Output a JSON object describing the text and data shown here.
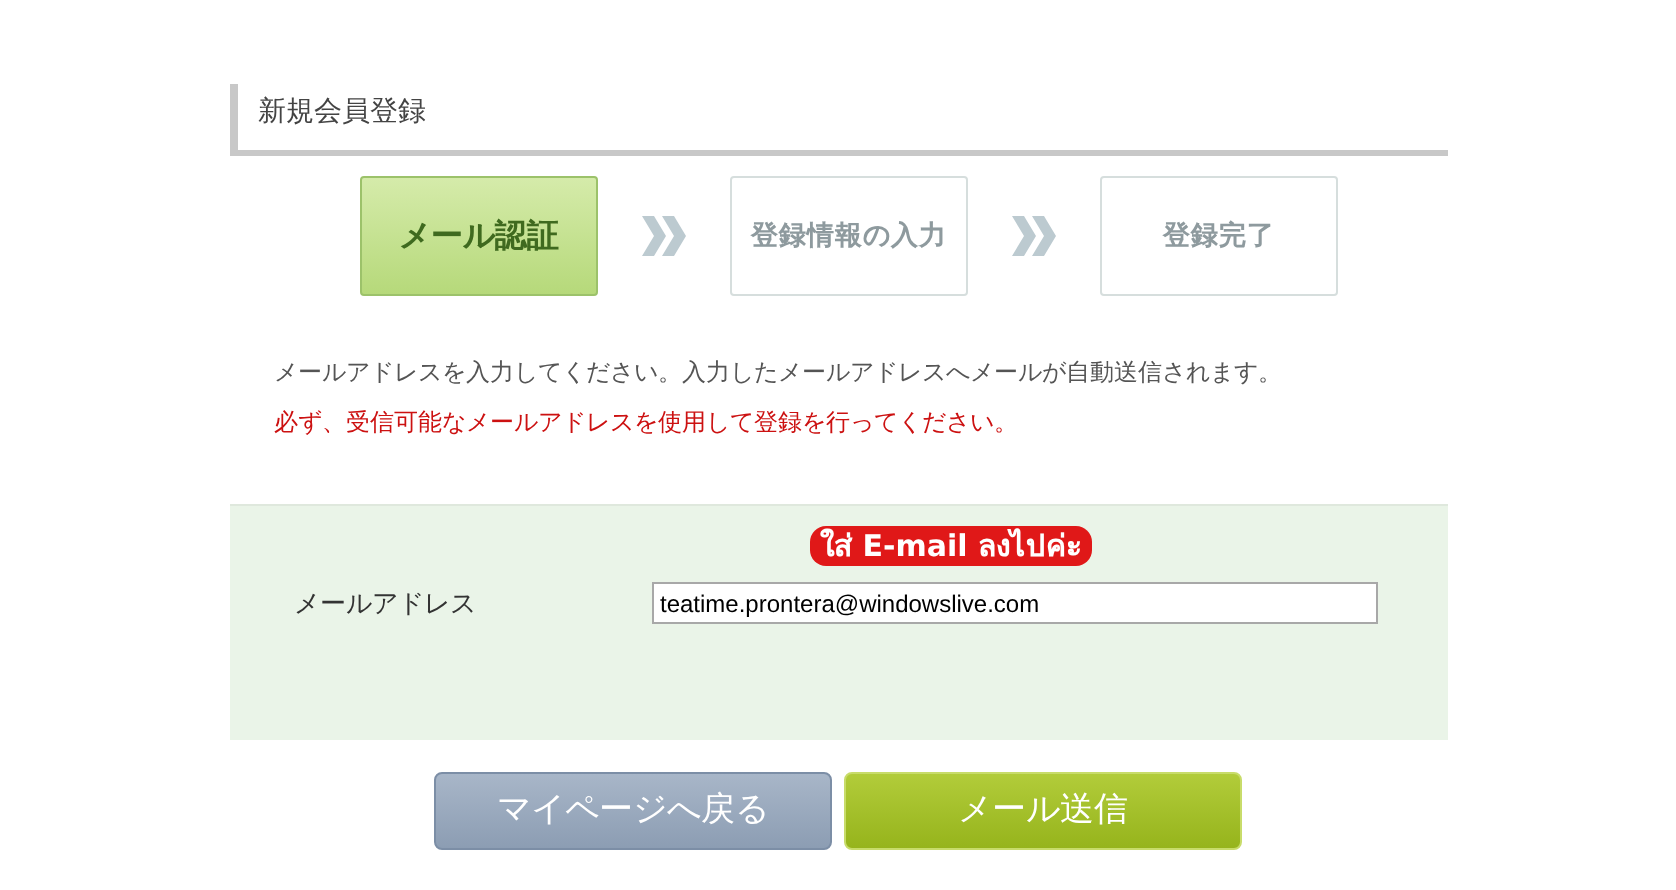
{
  "page_title": "新規会員登録",
  "steps": [
    {
      "label": "メール認証",
      "selected": true
    },
    {
      "label": "登録情報の入力",
      "selected": false
    },
    {
      "label": "登録完了",
      "selected": false
    }
  ],
  "instructions": [
    {
      "text": "メールアドレスを入力してください。入力したメールアドレスへメールが自動送信されます。",
      "kind": "normal"
    },
    {
      "text": "必ず、受信可能なメールアドレスを使用して登録を行ってください。",
      "kind": "warning"
    }
  ],
  "form": {
    "annotation": "ใส่ E-mail ลงไปค่ะ",
    "label": "メールアドレス",
    "value": "teatime.prontera@windowslive.com"
  },
  "buttons": [
    {
      "label": "マイページへ戻る",
      "kind": "back"
    },
    {
      "label": "メール送信",
      "kind": "submit"
    }
  ]
}
